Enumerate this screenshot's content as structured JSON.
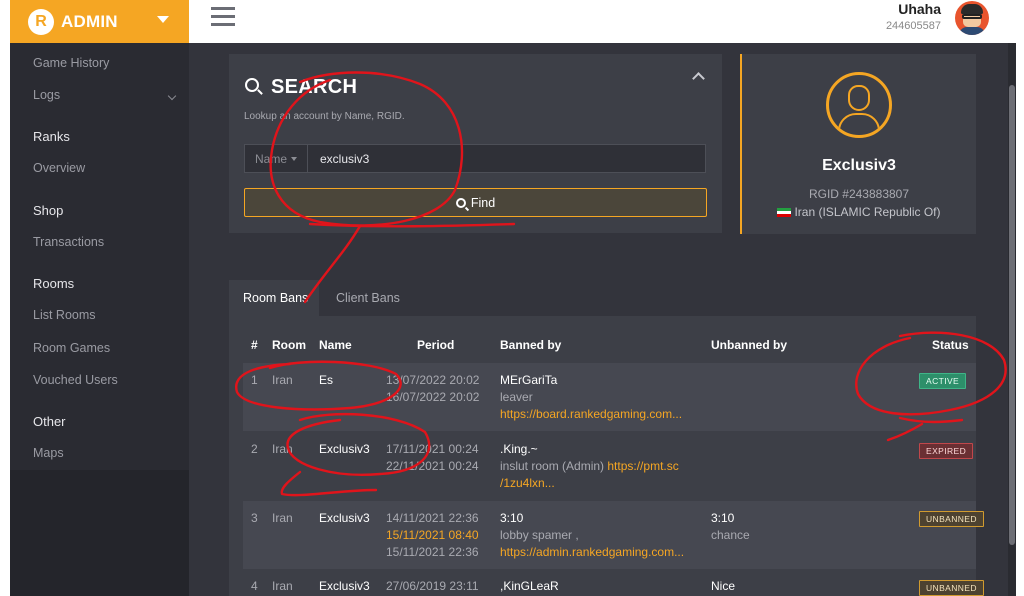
{
  "brand": {
    "name": "ADMIN"
  },
  "header": {
    "user_name": "Uhaha",
    "user_id": "244605587"
  },
  "sidebar": {
    "items": [
      {
        "label": "Game History"
      },
      {
        "label": "Logs"
      },
      {
        "label": "Ranks"
      },
      {
        "label": "Overview"
      },
      {
        "label": "Shop"
      },
      {
        "label": "Transactions"
      },
      {
        "label": "Rooms"
      },
      {
        "label": "List Rooms"
      },
      {
        "label": "Room Games"
      },
      {
        "label": "Vouched Users"
      },
      {
        "label": "Other"
      },
      {
        "label": "Maps"
      }
    ]
  },
  "search": {
    "title": "SEARCH",
    "hint": "Lookup an account by Name, RGID.",
    "type_label": "Name",
    "value": "exclusiv3",
    "find_label": "Find"
  },
  "profile": {
    "name": "Exclusiv3",
    "rgid": "RGID #243883807",
    "country": "Iran (ISLAMIC Republic Of)"
  },
  "bans": {
    "tabs": [
      {
        "label": "Room Bans"
      },
      {
        "label": "Client Bans"
      }
    ],
    "headers": [
      "#",
      "Room",
      "Name",
      "Period",
      "Banned by",
      "Unbanned by",
      "Status"
    ],
    "rows": [
      {
        "num": "1",
        "room": "Iran",
        "name": "Es",
        "p1d": "13/07/2022",
        "p1t": "20:02",
        "p2d": "16/07/2022",
        "p2t": "20:02",
        "by": "MErGariTa",
        "reason": "leaver",
        "link": "https://board.rankedgaming.com...",
        "status": "ACTIVE"
      },
      {
        "num": "2",
        "room": "Iran",
        "name": "Exclusiv3",
        "p1d": "17/11/2021",
        "p1t": "00:24",
        "p2d": "22/11/2021",
        "p2t": "00:24",
        "by": ".King.~",
        "reason": "inslut room (Admin) ",
        "link": "https://pmt.sc",
        "link2": "/1zu4lxn...",
        "status": "EXPIRED"
      },
      {
        "num": "3",
        "room": "Iran",
        "name": "Exclusiv3",
        "p1d": "14/11/2021",
        "p1t": "22:36",
        "p2d": "15/11/2021",
        "p2t": "08:40",
        "p3d": "15/11/2021",
        "p3t": "22:36",
        "by": "3:10",
        "reason": "lobby spamer ,",
        "link": "https://admin.rankedgaming.com...",
        "unby": "3:10",
        "unreason": "chance",
        "status": "UNBANNED"
      },
      {
        "num": "4",
        "room": "Iran",
        "name": "Exclusiv3",
        "p1d": "27/06/2019",
        "p1t": "23:11",
        "by": ",KinGLeaR",
        "unby": "Nice",
        "status": "UNBANNED"
      }
    ]
  },
  "colors": {
    "accent": "#f5a623",
    "active": "#2d8f6a",
    "expired": "#c0474b",
    "unbanned": "#d19b2f",
    "annotation": "#e0141b"
  }
}
